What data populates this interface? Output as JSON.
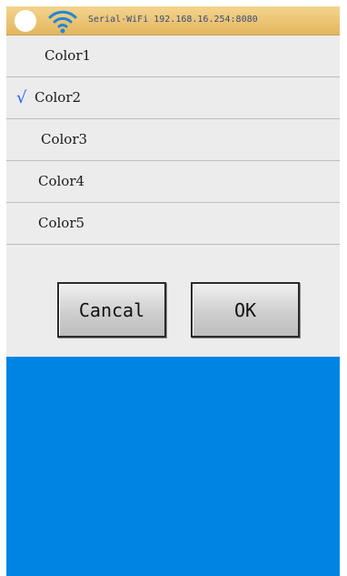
{
  "status_bar": {
    "text": "Serial-WiFi 192.168.16.254:8080",
    "icons": [
      "status-dot",
      "wifi-icon"
    ]
  },
  "color_list": {
    "items": [
      {
        "label": "Color1",
        "selected": false
      },
      {
        "label": "Color2",
        "selected": true
      },
      {
        "label": "Color3",
        "selected": false
      },
      {
        "label": "Color4",
        "selected": false
      },
      {
        "label": "Color5",
        "selected": false
      }
    ],
    "check_mark": "√"
  },
  "buttons": {
    "cancel_label": "Cancal",
    "ok_label": "OK"
  },
  "colors": {
    "status_bar": "#e3b65e",
    "background": "#ececec",
    "panel": "#0084e3",
    "check": "#1f5fff"
  }
}
